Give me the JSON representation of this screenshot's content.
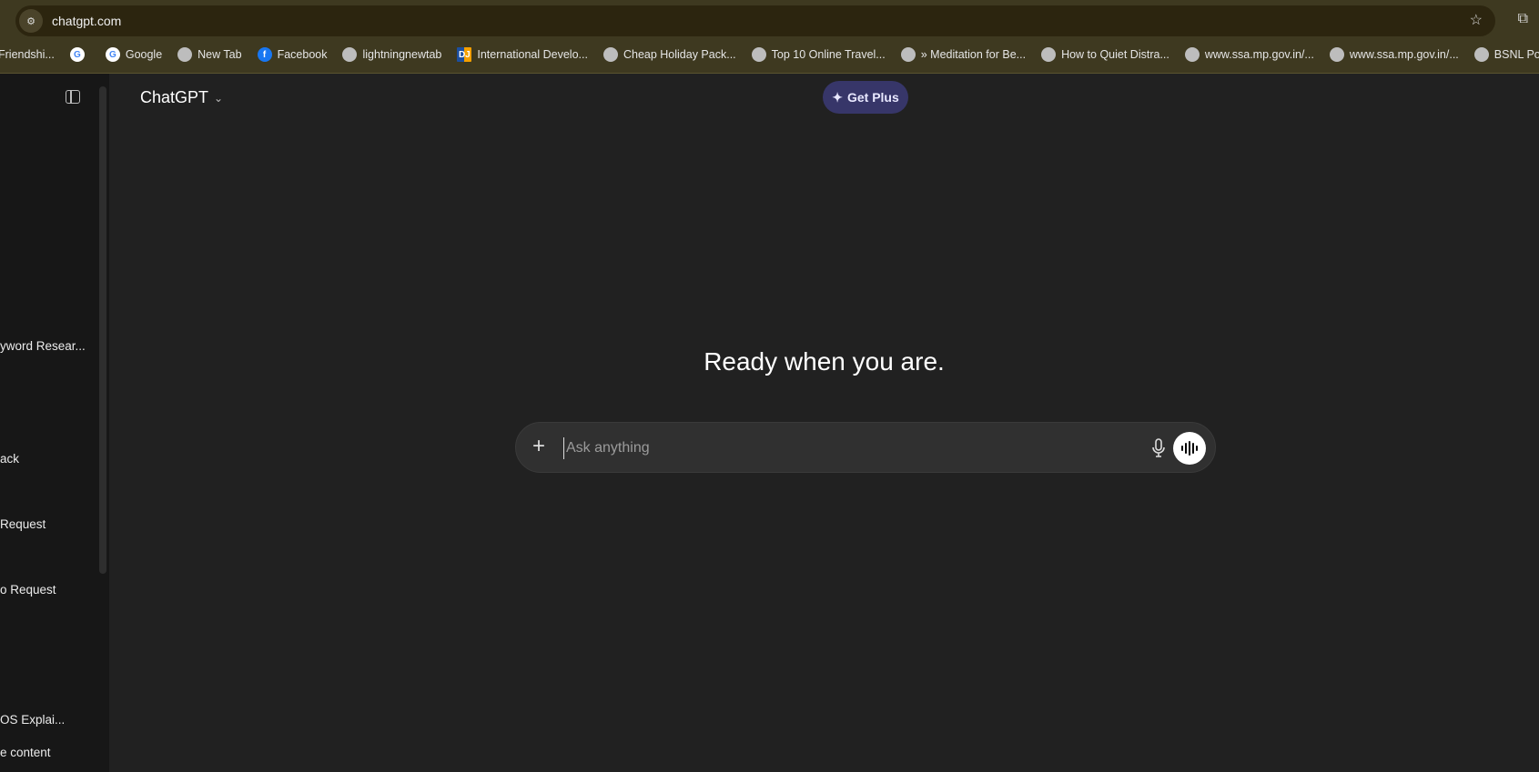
{
  "browser": {
    "url": "chatgpt.com",
    "bookmarks": [
      {
        "label": "Friendshi...",
        "icon": "none"
      },
      {
        "label": "",
        "icon": "google-icon"
      },
      {
        "label": "Google",
        "icon": "google-icon"
      },
      {
        "label": "New Tab",
        "icon": "globe-icon"
      },
      {
        "label": "Facebook",
        "icon": "facebook-icon"
      },
      {
        "label": "lightningnewtab",
        "icon": "globe-icon"
      },
      {
        "label": "International Develo...",
        "icon": "dj-icon"
      },
      {
        "label": "Cheap Holiday Pack...",
        "icon": "globe-icon"
      },
      {
        "label": "Top 10 Online Travel...",
        "icon": "globe-icon"
      },
      {
        "label": "» Meditation for Be...",
        "icon": "globe-icon"
      },
      {
        "label": "How to Quiet Distra...",
        "icon": "globe-icon"
      },
      {
        "label": "www.ssa.mp.gov.in/...",
        "icon": "globe-icon"
      },
      {
        "label": "www.ssa.mp.gov.in/...",
        "icon": "globe-icon"
      },
      {
        "label": "BSNL Portal || Value...",
        "icon": "globe-icon"
      }
    ]
  },
  "sidebar": {
    "items": [
      {
        "label": "yword Resear..."
      },
      {
        "label": "ack"
      },
      {
        "label": "Request"
      },
      {
        "label": "o Request"
      },
      {
        "label": "OS Explai..."
      },
      {
        "label": "e content"
      }
    ]
  },
  "header": {
    "title": "ChatGPT",
    "get_plus": "Get Plus"
  },
  "main": {
    "heading": "Ready when you are.",
    "composer_placeholder": "Ask anything"
  },
  "colors": {
    "background": "#212121",
    "sidebar": "#171717",
    "accent": "#373669"
  }
}
